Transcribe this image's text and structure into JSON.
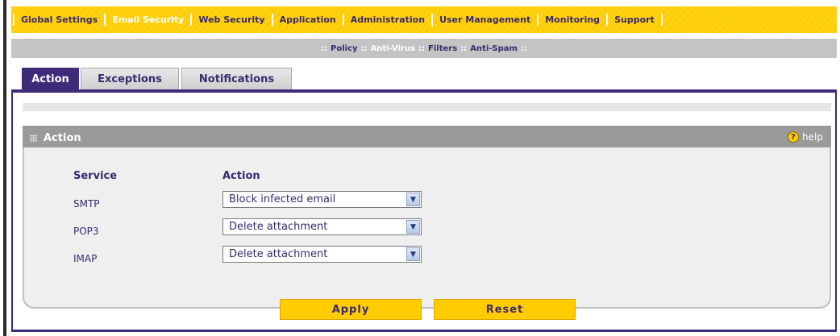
{
  "top_menu": [
    {
      "label": "Global Settings"
    },
    {
      "label": "Email Security",
      "active": true
    },
    {
      "label": "Web Security"
    },
    {
      "label": "Application"
    },
    {
      "label": "Administration"
    },
    {
      "label": "User Management"
    },
    {
      "label": "Monitoring"
    },
    {
      "label": "Support"
    }
  ],
  "sub_menu": [
    {
      "label": "Policy"
    },
    {
      "label": "Anti-Virus",
      "active": true
    },
    {
      "label": "Filters"
    },
    {
      "label": "Anti-Spam"
    }
  ],
  "tabs": [
    {
      "label": "Action",
      "active": true
    },
    {
      "label": "Exceptions"
    },
    {
      "label": "Notifications"
    }
  ],
  "section": {
    "title": "Action",
    "help_label": "help"
  },
  "table": {
    "service_header": "Service",
    "action_header": "Action",
    "rows": [
      {
        "service": "SMTP",
        "action": "Block infected email"
      },
      {
        "service": "POP3",
        "action": "Delete attachment"
      },
      {
        "service": "IMAP",
        "action": "Delete attachment"
      }
    ]
  },
  "buttons": {
    "apply": "Apply",
    "reset": "Reset"
  },
  "colors": {
    "accent_yellow": "#ffcc00",
    "brand_purple": "#3e2b7a",
    "section_gray": "#9a9a9a"
  }
}
